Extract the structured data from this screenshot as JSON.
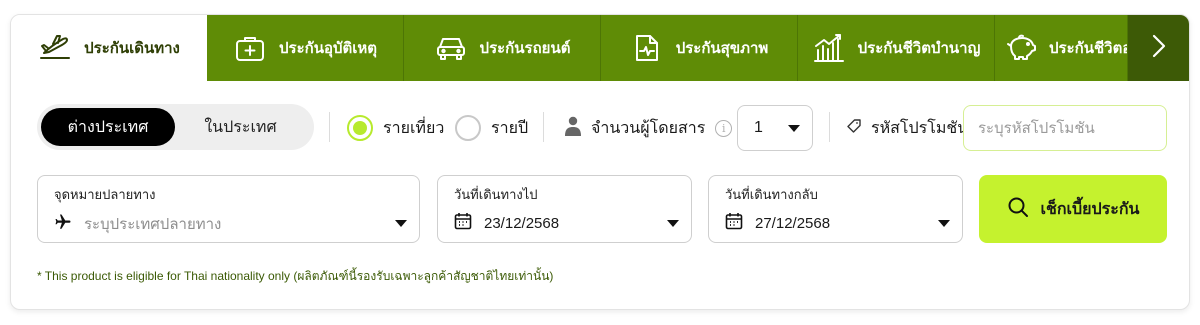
{
  "tabs": [
    {
      "label": "ประกันเดินทาง",
      "icon": "airplane-departure-icon",
      "active": true
    },
    {
      "label": "ประกันอุบัติเหตุ",
      "icon": "medical-kit-icon",
      "active": false
    },
    {
      "label": "ประกันรถยนต์",
      "icon": "car-icon",
      "active": false
    },
    {
      "label": "ประกันสุขภาพ",
      "icon": "health-document-icon",
      "active": false
    },
    {
      "label": "ประกันชีวิตบำนาญ",
      "icon": "growth-chart-icon",
      "active": false
    },
    {
      "label": "ประกันชีวิตออ",
      "icon": "piggy-bank-icon",
      "active": false
    }
  ],
  "trip_scope": {
    "selected": "ต่างประเทศ",
    "other": "ในประเทศ"
  },
  "trip_type": {
    "per_trip": "รายเที่ยว",
    "annual": "รายปี",
    "selected": "per_trip"
  },
  "passengers": {
    "label": "จำนวนผู้โดยสาร",
    "info_symbol": "i",
    "value": "1"
  },
  "promo": {
    "label": "รหัสโปรโมชัน",
    "placeholder": "ระบุรหัสโปรโมชัน"
  },
  "destination": {
    "label": "จุดหมายปลายทาง",
    "placeholder": "ระบุประเทศปลายทาง"
  },
  "depart_date": {
    "label": "วันที่เดินทางไป",
    "value": "23/12/2568"
  },
  "return_date": {
    "label": "วันที่เดินทางกลับ",
    "value": "27/12/2568"
  },
  "search": {
    "label": "เช็กเบี้ยประกัน"
  },
  "note": "* This product is eligible for Thai nationality only (ผลิตภัณฑ์นี้รองรับเฉพาะลูกค้าสัญชาติไทยเท่านั้น)",
  "colors": {
    "tab_green": "#5f8c06",
    "tab_dark": "#3d5a06",
    "lime": "#c5f22e",
    "active_text": "#2f3f05"
  }
}
